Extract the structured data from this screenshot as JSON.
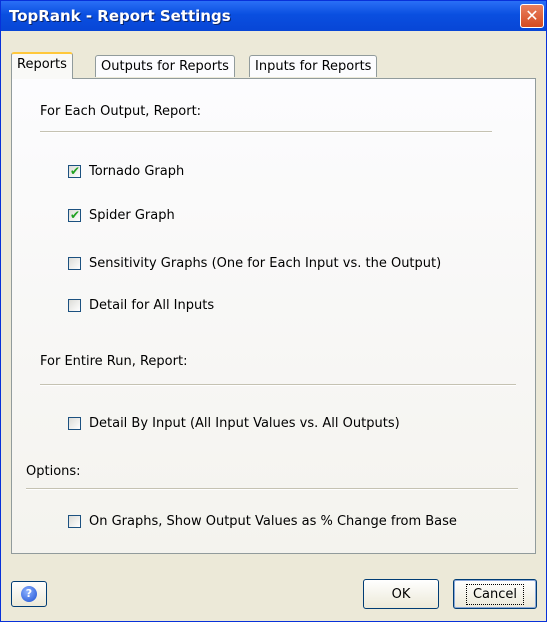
{
  "window": {
    "title": "TopRank - Report Settings",
    "close_glyph": "✕"
  },
  "tabs": [
    {
      "label": "Reports",
      "active": true
    },
    {
      "label": "Outputs for Reports",
      "active": false
    },
    {
      "label": "Inputs for Reports",
      "active": false
    }
  ],
  "sections": {
    "each_output": "For Each Output, Report:",
    "entire_run": "For Entire Run, Report:",
    "options": "Options:"
  },
  "checkboxes": [
    {
      "label": "Tornado Graph",
      "checked": true
    },
    {
      "label": "Spider Graph",
      "checked": true
    },
    {
      "label": "Sensitivity Graphs (One for Each Input vs. the Output)",
      "checked": false
    },
    {
      "label": "Detail for All Inputs",
      "checked": false
    },
    {
      "label": "Detail By Input (All Input Values vs. All Outputs)",
      "checked": false
    },
    {
      "label": "On Graphs, Show Output Values as % Change from Base",
      "checked": false
    }
  ],
  "footer": {
    "help_icon": "help-icon",
    "help_glyph": "?",
    "ok_label": "OK",
    "cancel_label": "Cancel"
  },
  "colors": {
    "title_bar": "#0a4fe0",
    "dialog_bg": "#ece9d8",
    "check_mark": "#21a121",
    "close_button": "#d44a20"
  }
}
